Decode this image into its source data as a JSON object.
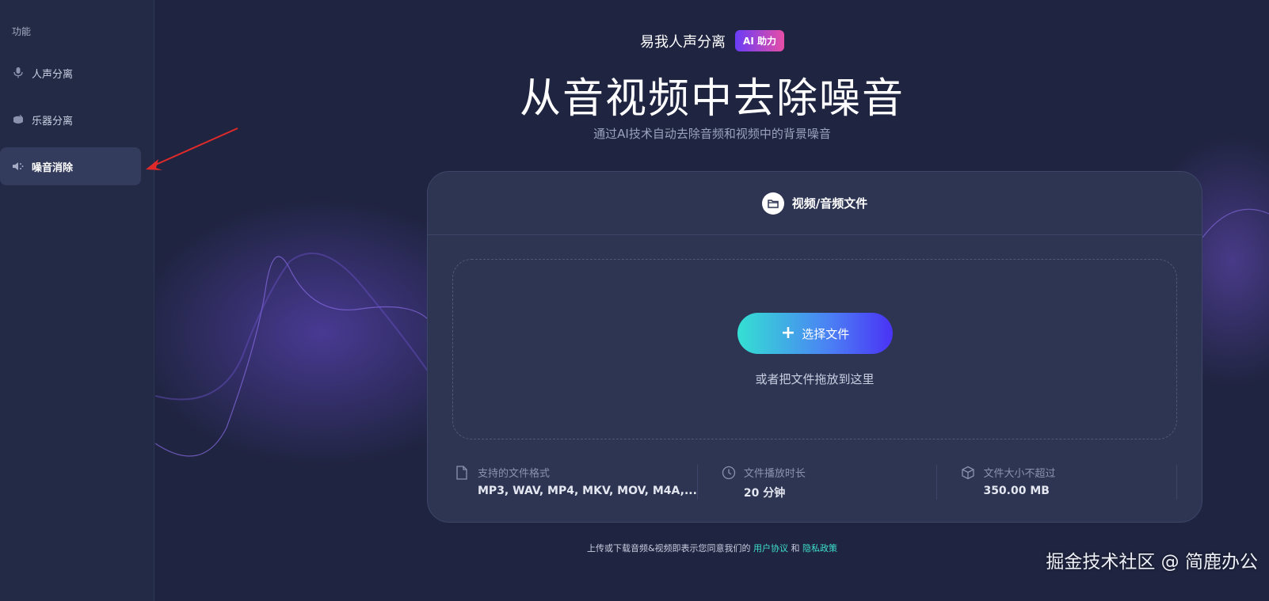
{
  "sidebar": {
    "heading": "功能",
    "items": [
      {
        "label": "人声分离",
        "icon": "microphone-icon",
        "active": false
      },
      {
        "label": "乐器分离",
        "icon": "drum-icon",
        "active": false
      },
      {
        "label": "噪音消除",
        "icon": "speaker-noise-icon",
        "active": true
      }
    ]
  },
  "header": {
    "brand": "易我人声分离",
    "badge": "AI 助力",
    "title": "从音视频中去除噪音",
    "subtitle": "通过AI技术自动去除音频和视频中的背景噪音"
  },
  "card": {
    "tab_label": "视频/音频文件",
    "select_button": "选择文件",
    "drop_hint": "或者把文件拖放到这里",
    "info": [
      {
        "icon": "file-icon",
        "label": "支持的文件格式",
        "value": "MP3, WAV, MP4, MKV, MOV, M4A,..."
      },
      {
        "icon": "clock-icon",
        "label": "文件播放时长",
        "value": "20 分钟"
      },
      {
        "icon": "box-icon",
        "label": "文件大小不超过",
        "value": "350.00 MB"
      }
    ]
  },
  "footer": {
    "prefix": "上传或下载音频&视频即表示您同意我们的",
    "terms_link": "用户协议",
    "and": "和",
    "privacy_link": "隐私政策"
  },
  "watermark": "掘金技术社区 @ 简鹿办公",
  "colors": {
    "background": "#1f2440",
    "sidebar": "#222a46",
    "card": "#2d3553",
    "accent_teal": "#3ee0cf",
    "accent_purple": "#4a32f5",
    "annotation_arrow": "#e02a2a"
  }
}
